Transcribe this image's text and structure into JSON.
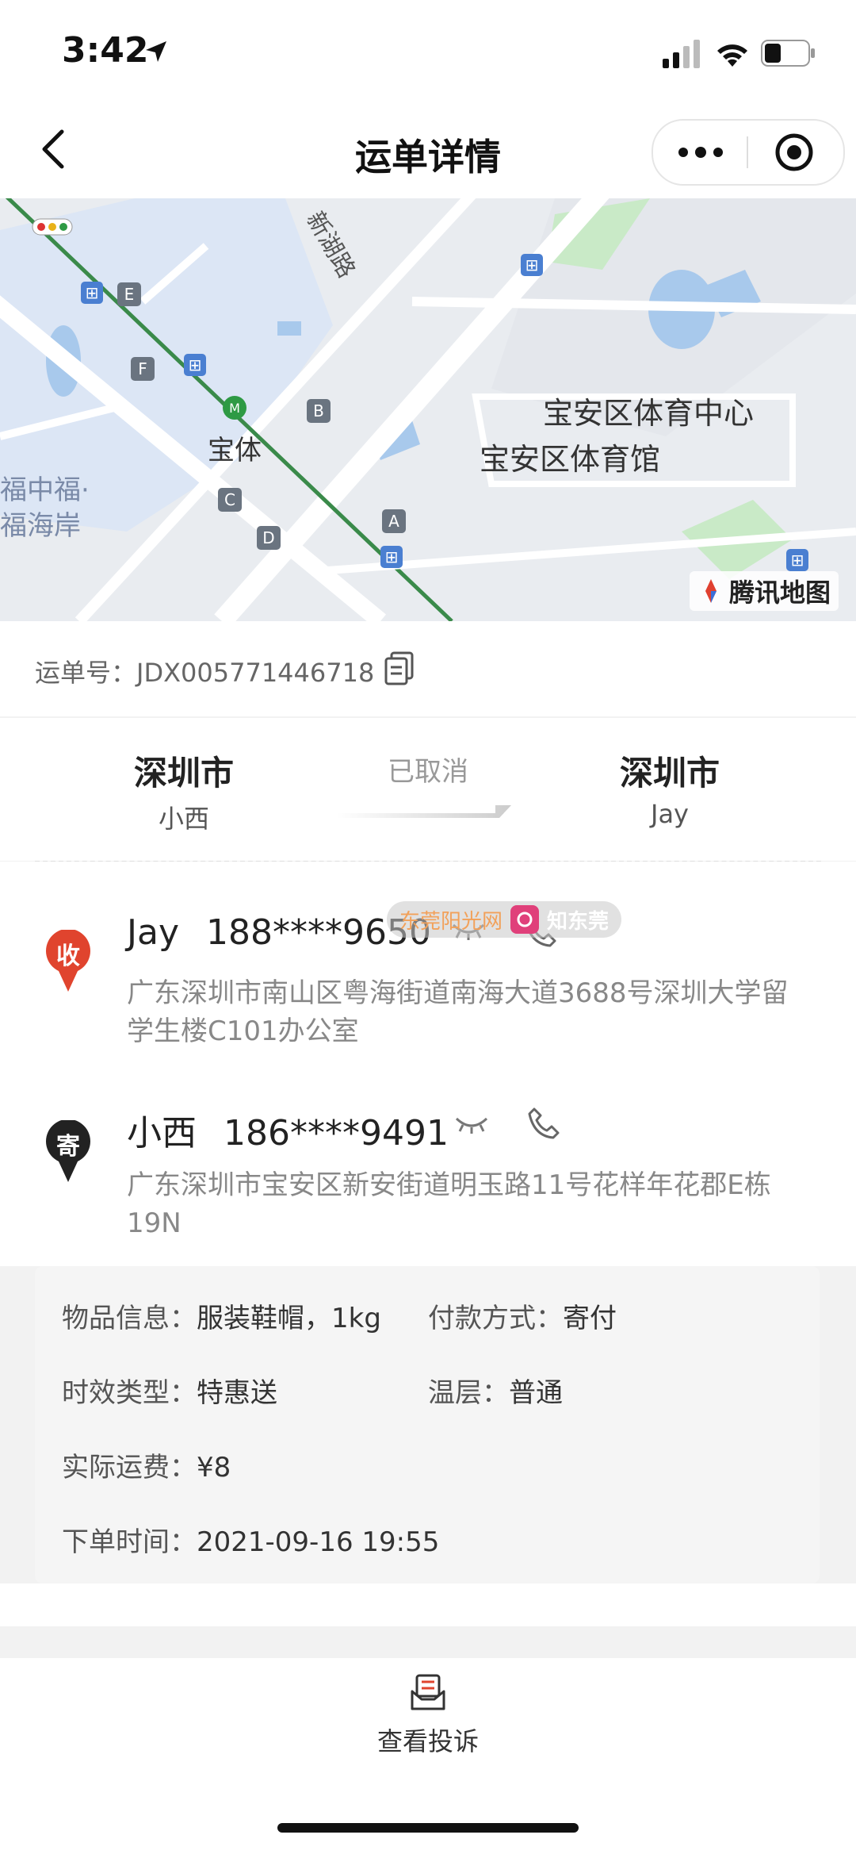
{
  "status_bar": {
    "time": "3:42"
  },
  "nav": {
    "title": "运单详情"
  },
  "map": {
    "labels": {
      "road": "新湖路",
      "station": "宝体",
      "center": "宝安区体育中心",
      "gym": "宝安区体育馆",
      "left_area1": "福中福·",
      "left_area2": "福海岸",
      "provider": "腾讯地图"
    },
    "exits": [
      "E",
      "F",
      "B",
      "C",
      "D",
      "A"
    ]
  },
  "waybill": {
    "label": "运单号：",
    "number": "JDX005771446718"
  },
  "route": {
    "from_city": "深圳市",
    "from_name": "小西",
    "status": "已取消",
    "to_city": "深圳市",
    "to_name": "Jay"
  },
  "receiver": {
    "badge": "收",
    "name": "Jay",
    "phone": "188****9650",
    "address": "广东深圳市南山区粤海街道南海大道3688号深圳大学留学生楼C101办公室"
  },
  "sender": {
    "badge": "寄",
    "name": "小西",
    "phone": "186****9491",
    "address": "广东深圳市宝安区新安街道明玉路11号花样年花郡E栋19N"
  },
  "watermark": {
    "left": "东莞阳光网",
    "right": "知东莞"
  },
  "info": {
    "goods_label": "物品信息：",
    "goods_value": "服装鞋帽，1kg",
    "pay_label": "付款方式：",
    "pay_value": "寄付",
    "timeliness_label": "时效类型：",
    "timeliness_value": "特惠送",
    "temp_label": "温层：",
    "temp_value": "普通",
    "fee_label": "实际运费：",
    "fee_value": "¥8",
    "order_time_label": "下单时间：",
    "order_time_value": "2021-09-16 19:55"
  },
  "bottom": {
    "complaint": "查看投诉"
  },
  "colors": {
    "receiver_badge": "#e0442e",
    "sender_badge": "#222222",
    "metro_line": "#3a8a4a"
  }
}
